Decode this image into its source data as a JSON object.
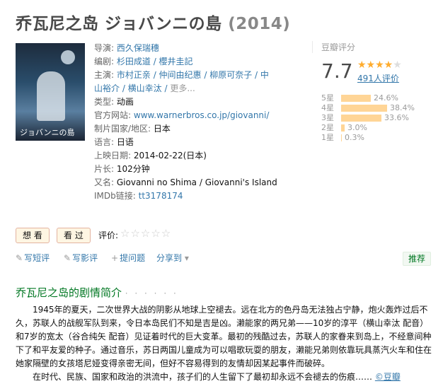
{
  "title": {
    "main": "乔瓦尼之岛 ジョバンニの島",
    "year": "(2014)"
  },
  "poster": {
    "title": "ジョバンニの島"
  },
  "info": {
    "director_label": "导演:",
    "director": "西久保瑞穗",
    "writer_label": "编剧:",
    "writer": "杉田成道 / 櫻井圭記",
    "cast_label": "主演:",
    "cast_line1": "市村正亲 / 仲间由纪惠 / 柳原可奈子 / 中",
    "cast_line2": "山裕介 / 横山幸汰 /",
    "cast_more": "更多...",
    "genre_label": "类型:",
    "genre": "动画",
    "site_label": "官方网站:",
    "site": "www.warnerbros.co.jp/giovanni/",
    "country_label": "制片国家/地区:",
    "country": "日本",
    "lang_label": "语言:",
    "lang": "日语",
    "date_label": "上映日期:",
    "date": "2014-02-22(日本)",
    "runtime_label": "片长:",
    "runtime": "102分钟",
    "aka_label": "又名:",
    "aka": "Giovanni no Shima / Giovanni's Island",
    "imdb_label": "IMDb链接:",
    "imdb": "tt3178174"
  },
  "rating": {
    "label": "豆瓣评分",
    "score": "7.7",
    "stars": 4,
    "votes": "491人评价",
    "bars": [
      {
        "star": "5星",
        "pct": "24.6%",
        "value": 24.6
      },
      {
        "star": "4星",
        "pct": "38.4%",
        "value": 38.4
      },
      {
        "star": "3星",
        "pct": "33.6%",
        "value": 33.6
      },
      {
        "star": "2星",
        "pct": "3.0%",
        "value": 3.0
      },
      {
        "star": "1星",
        "pct": "0.3%",
        "value": 0.3
      }
    ]
  },
  "buttons": {
    "want": "想 看",
    "seen": "看 过",
    "rate_label": "评价:"
  },
  "actions": {
    "short_review": "写短评",
    "review": "写影评",
    "question": "提问题",
    "share": "分享到",
    "recommend": "推荐"
  },
  "summary": {
    "heading": "乔瓦尼之岛的剧情简介",
    "dots": "· · · · · ·",
    "p1": "1945年的夏天，二次世界大战的阴影从地球上空褪去。远在北方的色丹岛无法独占宁静，炮火轰炸过后不久，苏联人的战舰军队到来，令日本岛民们不知是吉是凶。濑能家的两兄弟——10岁的淳平（横山幸汰 配音）和7岁的宽太（谷合纯矢 配音）见证着时代的巨大变革。最初的残酷过去，苏联人的家眷来到岛上，不经意间种下了和平友爱的种子。通过音乐，苏日两国儿童成为可以唱歌玩耍的朋友，濑能兄弟则依靠玩具蒸汽火车和住在她家隔壁的女孩塔尼娅变得亲密无间，但好不容易得到的友情却因某起事件而破碎。",
    "p2": "在时代、民族、国家和政治的洪流中，孩子们的人生留下了最初却永远不会褪去的伤痕……",
    "source": "©豆瓣"
  }
}
